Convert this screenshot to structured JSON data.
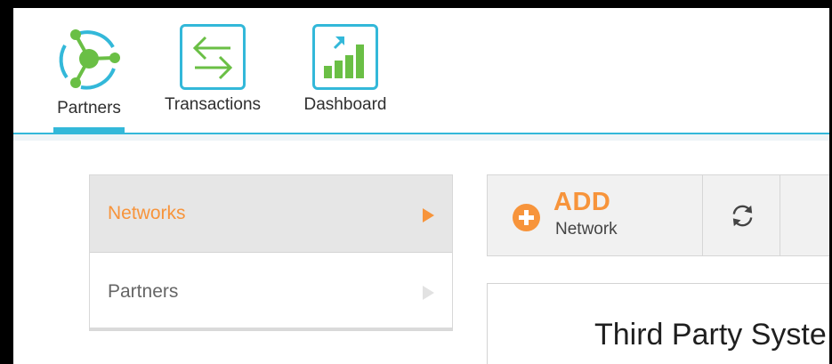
{
  "nav": {
    "items": [
      {
        "label": "Partners",
        "icon": "partners-network-icon",
        "active": true
      },
      {
        "label": "Transactions",
        "icon": "transactions-arrows-icon",
        "active": false
      },
      {
        "label": "Dashboard",
        "icon": "dashboard-chart-icon",
        "active": false
      }
    ]
  },
  "sidemenu": {
    "items": [
      {
        "label": "Networks",
        "active": true
      },
      {
        "label": "Partners",
        "active": false
      }
    ]
  },
  "toolbar": {
    "add_title": "ADD",
    "add_subtitle": "Network",
    "refresh_icon": "refresh-icon"
  },
  "panel": {
    "title": "Third Party Syste"
  },
  "colors": {
    "accent_blue": "#33b8d9",
    "accent_orange": "#f7943b",
    "icon_green": "#6abf45"
  }
}
